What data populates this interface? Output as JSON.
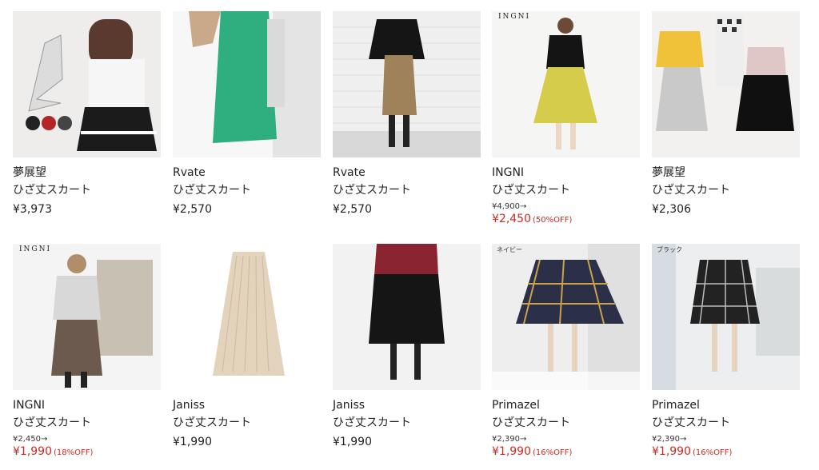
{
  "products": [
    {
      "brand": "夢展望",
      "category": "ひざ丈スカート",
      "price": "¥3,973"
    },
    {
      "brand": "Rvate",
      "category": "ひざ丈スカート",
      "price": "¥2,570"
    },
    {
      "brand": "Rvate",
      "category": "ひざ丈スカート",
      "price": "¥2,570"
    },
    {
      "brand": "INGNI",
      "category": "ひざ丈スカート",
      "original": "¥4,900→",
      "sale": "¥2,450",
      "off": "(50%OFF)",
      "image_label": "INGNI"
    },
    {
      "brand": "夢展望",
      "category": "ひざ丈スカート",
      "price": "¥2,306"
    },
    {
      "brand": "INGNI",
      "category": "ひざ丈スカート",
      "original": "¥2,450→",
      "sale": "¥1,990",
      "off": "(18%OFF)",
      "image_label": "INGNI"
    },
    {
      "brand": "Janiss",
      "category": "ひざ丈スカート",
      "price": "¥1,990"
    },
    {
      "brand": "Janiss",
      "category": "ひざ丈スカート",
      "price": "¥1,990"
    },
    {
      "brand": "Primazel",
      "category": "ひざ丈スカート",
      "original": "¥2,390→",
      "sale": "¥1,990",
      "off": "(16%OFF)",
      "image_tag": "ネイビー"
    },
    {
      "brand": "Primazel",
      "category": "ひざ丈スカート",
      "original": "¥2,390→",
      "sale": "¥1,990",
      "off": "(16%OFF)",
      "image_tag": "ブラック"
    }
  ],
  "colors": {
    "sale": "#d0281f",
    "text": "#222222"
  }
}
